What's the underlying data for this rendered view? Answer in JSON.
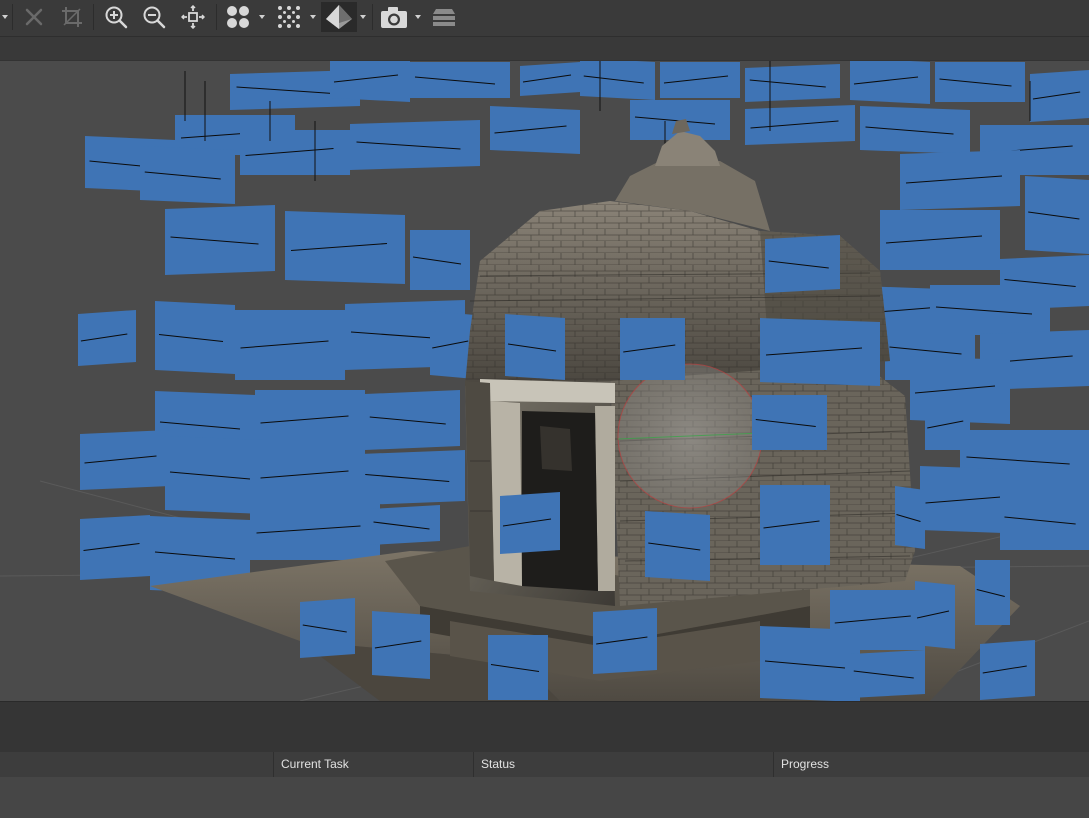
{
  "toolbar": {
    "tools": [
      {
        "name": "dropdown-arrow",
        "enabled": true
      },
      {
        "name": "close-icon",
        "enabled": false
      },
      {
        "name": "crop-icon",
        "enabled": false
      },
      {
        "name": "zoom-in-icon",
        "enabled": true
      },
      {
        "name": "zoom-out-icon",
        "enabled": true
      },
      {
        "name": "fit-view-icon",
        "enabled": true
      },
      {
        "name": "point-size-icon",
        "enabled": true
      },
      {
        "name": "point-cloud-icon",
        "enabled": true
      },
      {
        "name": "textured-model-icon",
        "enabled": true,
        "active": true
      },
      {
        "name": "camera-icon",
        "enabled": true
      },
      {
        "name": "layers-icon",
        "enabled": true
      }
    ]
  },
  "viewport": {
    "background": "#4b4b4b",
    "camera_color": "#3f74b5",
    "content": "textured-model"
  },
  "task_panel": {
    "columns": [
      {
        "key": "task",
        "label": ""
      },
      {
        "key": "current_task",
        "label": "Current Task"
      },
      {
        "key": "status",
        "label": "Status"
      },
      {
        "key": "progress",
        "label": "Progress"
      }
    ]
  }
}
